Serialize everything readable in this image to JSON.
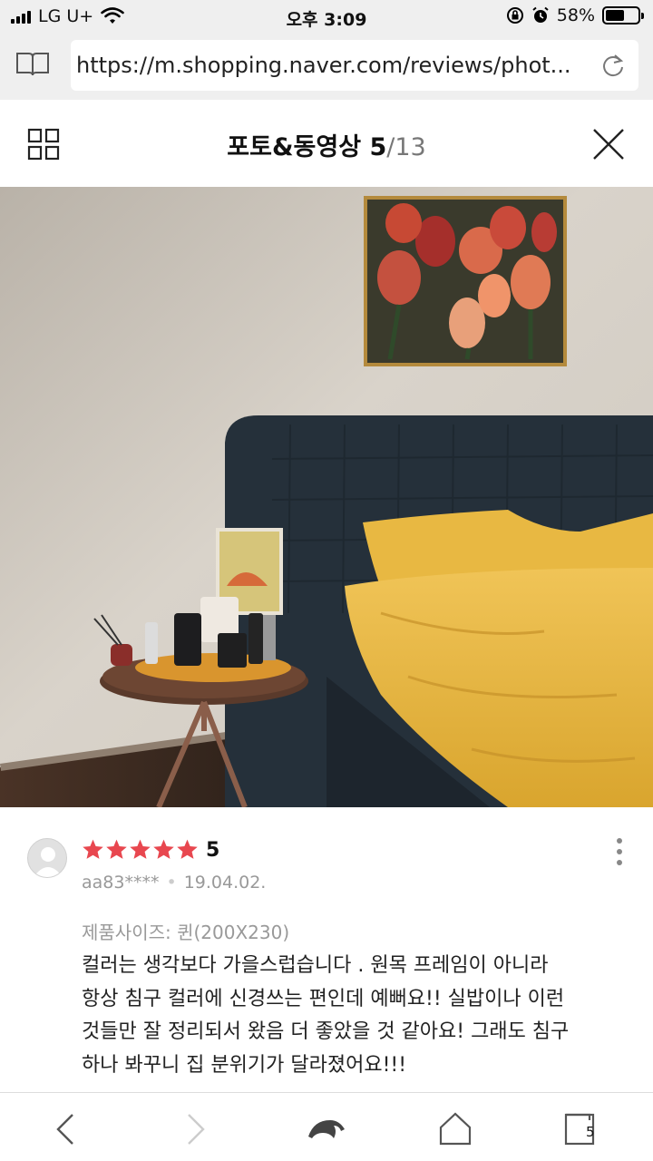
{
  "status_bar": {
    "carrier": "LG U+",
    "time": "오후 3:09",
    "battery_percent": "58%",
    "battery_level": 0.58
  },
  "browser": {
    "url": "https://m.shopping.naver.com/reviews/phot..."
  },
  "header": {
    "title": "포토&동영상",
    "current_index": "5",
    "total": "/13"
  },
  "review": {
    "stars": 5,
    "rating": "5",
    "user": "aa83****",
    "date": "19.04.02.",
    "option": "제품사이즈: 퀸(200X230)",
    "body_lines": [
      "컬러는 생각보다 가을스럽습니다 . 원목 프레임이 아니라",
      "항상 침구 컬러에 신경쓰는 편인데 예뻐요!! 실밥이나 이런",
      "것들만 잘 정리되서 왔음 더 좋았을 것 같아요! 그래도 침구",
      "하나 봐꾸니 집 분위기가 달라졌어요!!!"
    ]
  },
  "toolbar": {
    "tab_count": "5"
  },
  "colors": {
    "star": "#e8474f",
    "chrome_bg": "#efefef",
    "bedding": "#e7b63c",
    "headboard": "#25303a"
  },
  "icons": {
    "back": "chevron-left-icon",
    "forward": "chevron-right-icon",
    "whale": "whale-icon",
    "home": "home-icon",
    "tabs": "tabs-icon",
    "grid": "grid-icon",
    "close": "close-icon",
    "reader": "book-icon",
    "reload": "reload-icon"
  }
}
